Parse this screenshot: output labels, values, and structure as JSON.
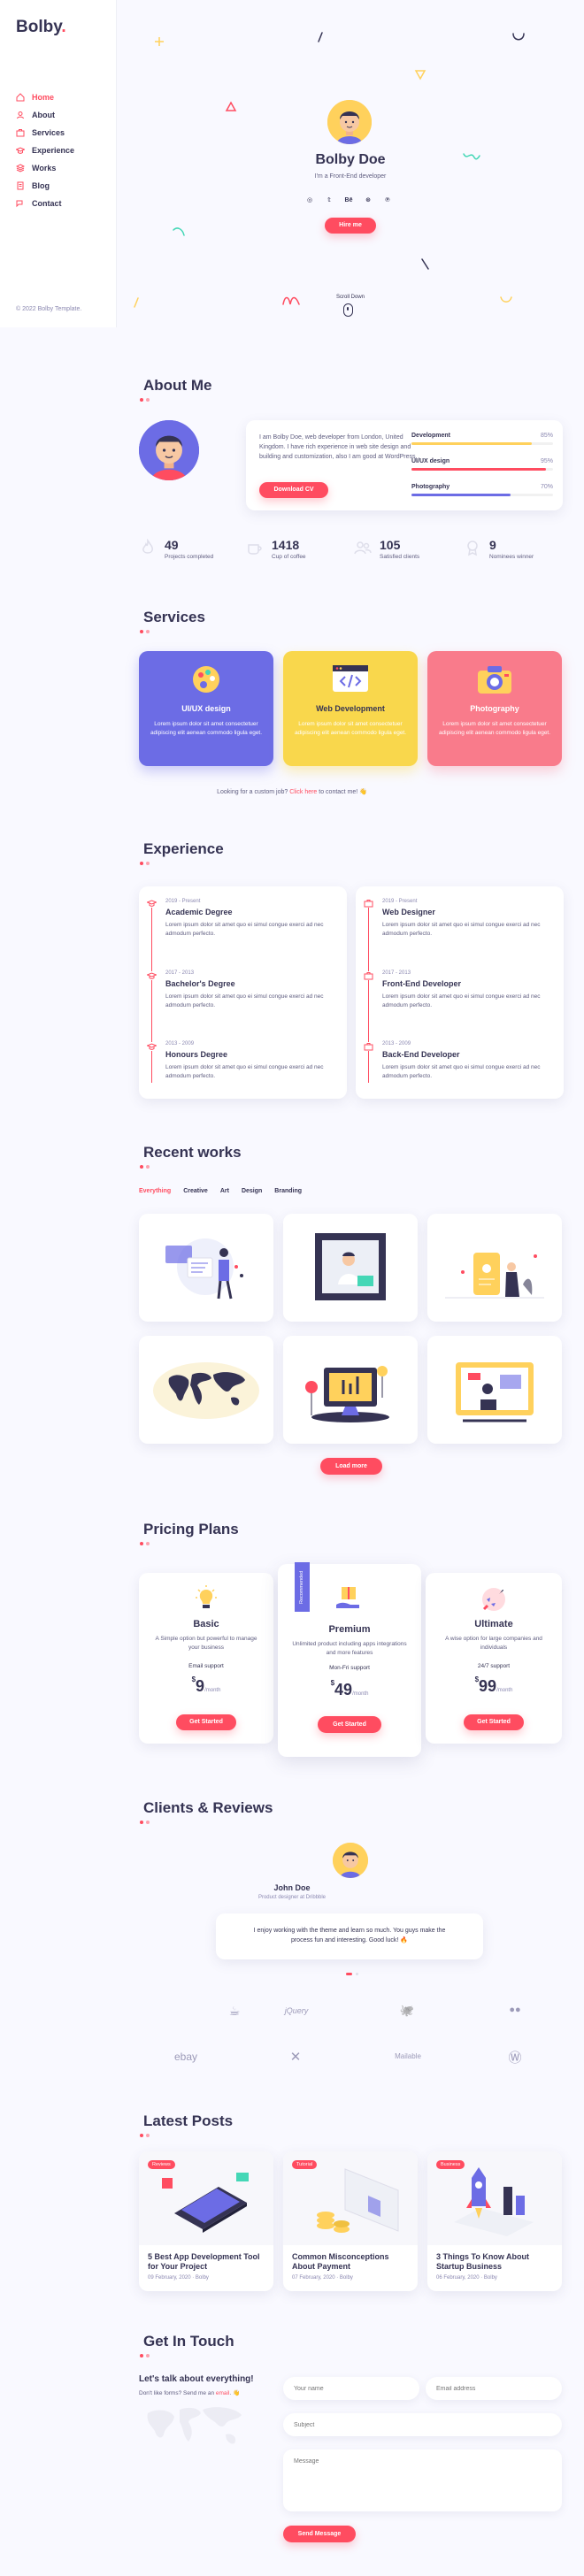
{
  "brand": {
    "name": "Bolby",
    "dot": "."
  },
  "nav": [
    {
      "label": "Home",
      "icon": "home-icon",
      "active": true
    },
    {
      "label": "About",
      "icon": "user-icon"
    },
    {
      "label": "Services",
      "icon": "briefcase-icon"
    },
    {
      "label": "Experience",
      "icon": "graduation-icon"
    },
    {
      "label": "Works",
      "icon": "layers-icon"
    },
    {
      "label": "Blog",
      "icon": "note-icon"
    },
    {
      "label": "Contact",
      "icon": "bubbles-icon"
    }
  ],
  "copyright": "© 2022 Bolby Template.",
  "hero": {
    "name": "Bolby Doe",
    "role": "I'm a Front-End developer",
    "socials": [
      "instagram-icon",
      "twitter-icon",
      "behance-icon",
      "dribbble-icon",
      "pinterest-icon"
    ],
    "social_glyphs": [
      "◎",
      "𝕥",
      "Bē",
      "⊛",
      "℗"
    ],
    "cta": "Hire me",
    "scroll": "Scroll Down"
  },
  "about": {
    "title": "About Me",
    "text": "I am Bolby Doe, web developer from London, United Kingdom. I have rich experience in web site design and building and customization, also I am good at WordPress.",
    "download": "Download CV",
    "skills": [
      {
        "name": "Development",
        "percent": 85,
        "color": "#ffd15c"
      },
      {
        "name": "UI/UX design",
        "percent": 95,
        "color": "#ff4c60"
      },
      {
        "name": "Photography",
        "percent": 70,
        "color": "#6c6ce5"
      }
    ],
    "skill_percent_labels": [
      "85%",
      "95%",
      "70%"
    ],
    "stats": [
      {
        "num": "49",
        "label": "Projects completed",
        "icon": "fire-icon"
      },
      {
        "num": "1418",
        "label": "Cup of coffee",
        "icon": "cup-icon"
      },
      {
        "num": "105",
        "label": "Satisfied clients",
        "icon": "people-icon"
      },
      {
        "num": "9",
        "label": "Nominees winner",
        "icon": "badge-icon"
      }
    ]
  },
  "services": {
    "title": "Services",
    "items": [
      {
        "title": "UI/UX design",
        "desc": "Lorem ipsum dolor sit amet consectetuer adipiscing elit aenean commodo ligula eget.",
        "color": "#6c6ce5",
        "icon": "palette-icon"
      },
      {
        "title": "Web Development",
        "desc": "Lorem ipsum dolor sit amet consectetuer adipiscing elit aenean commodo ligula eget.",
        "color": "#f9d74c",
        "icon": "code-window-icon"
      },
      {
        "title": "Photography",
        "desc": "Lorem ipsum dolor sit amet consectetuer adipiscing elit aenean commodo ligula eget.",
        "color": "#f97b8b",
        "icon": "camera-icon"
      }
    ],
    "custom_pre": "Looking for a custom job? ",
    "custom_link": "Click here",
    "custom_post": " to contact me! 👋"
  },
  "experience": {
    "title": "Experience",
    "education": [
      {
        "date": "2019 - Present",
        "title": "Academic Degree",
        "desc": "Lorem ipsum dolor sit amet quo ei simul congue exerci ad nec admodum perfecto."
      },
      {
        "date": "2017 - 2013",
        "title": "Bachelor's Degree",
        "desc": "Lorem ipsum dolor sit amet quo ei simul congue exerci ad nec admodum perfecto."
      },
      {
        "date": "2013 - 2009",
        "title": "Honours Degree",
        "desc": "Lorem ipsum dolor sit amet quo ei simul congue exerci ad nec admodum perfecto."
      }
    ],
    "work": [
      {
        "date": "2019 - Present",
        "title": "Web Designer",
        "desc": "Lorem ipsum dolor sit amet quo ei simul congue exerci ad nec admodum perfecto."
      },
      {
        "date": "2017 - 2013",
        "title": "Front-End Developer",
        "desc": "Lorem ipsum dolor sit amet quo ei simul congue exerci ad nec admodum perfecto."
      },
      {
        "date": "2013 - 2009",
        "title": "Back-End Developer",
        "desc": "Lorem ipsum dolor sit amet quo ei simul congue exerci ad nec admodum perfecto."
      }
    ]
  },
  "works": {
    "title": "Recent works",
    "filters": [
      "Everything",
      "Creative",
      "Art",
      "Design",
      "Branding"
    ],
    "load_more": "Load more"
  },
  "pricing": {
    "title": "Pricing Plans",
    "recommended": "Recommended",
    "plans": [
      {
        "name": "Basic",
        "desc": "A Simple option but powerful to manage your business",
        "support": "Email support",
        "currency": "$",
        "amount": "9",
        "period": "/month",
        "cta": "Get Started",
        "icon": "lightbulb-icon"
      },
      {
        "name": "Premium",
        "desc": "Unlimited product including apps integrations and more features",
        "support": "Mon-Fri support",
        "currency": "$",
        "amount": "49",
        "period": "/month",
        "cta": "Get Started",
        "icon": "gift-hand-icon"
      },
      {
        "name": "Ultimate",
        "desc": "A wise option for large companies and individuals",
        "support": "24/7 support",
        "currency": "$",
        "amount": "99",
        "period": "/month",
        "cta": "Get Started",
        "icon": "rocket-icon"
      }
    ]
  },
  "reviews": {
    "title": "Clients & Reviews",
    "name": "John Doe",
    "role": "Product designer at Dribbble",
    "quote": "I enjoy working with the theme and learn so much. You guys make the process fun and interesting. Good luck! 🔥",
    "clients": [
      "java-logo",
      "jquery-logo",
      "github-logo",
      "flickr-logo",
      "ebay-logo",
      "xamarin-logo",
      "mailable-logo",
      "wordpress-logo"
    ],
    "client_texts": [
      "☕",
      "jQuery",
      "🐙",
      "●●",
      "ebay",
      "✕",
      "Mailable",
      "Ⓦ"
    ]
  },
  "blog": {
    "title": "Latest Posts",
    "posts": [
      {
        "tag": "Reviews",
        "title": "5 Best App Development Tool for Your Project",
        "meta": "09 February, 2020 · Bolby"
      },
      {
        "tag": "Tutorial",
        "title": "Common Misconceptions About Payment",
        "meta": "07 February, 2020 · Bolby"
      },
      {
        "tag": "Business",
        "title": "3 Things To Know About Startup Business",
        "meta": "06 February, 2020 · Bolby"
      }
    ]
  },
  "contact": {
    "title": "Get In Touch",
    "heading": "Let's talk about everything!",
    "sub_pre": "Don't like forms? Send me an ",
    "sub_link": "email",
    "sub_post": ". 👋",
    "name_ph": "Your name",
    "email_ph": "Email address",
    "subject_ph": "Subject",
    "message_ph": "Message",
    "send": "Send Message"
  }
}
